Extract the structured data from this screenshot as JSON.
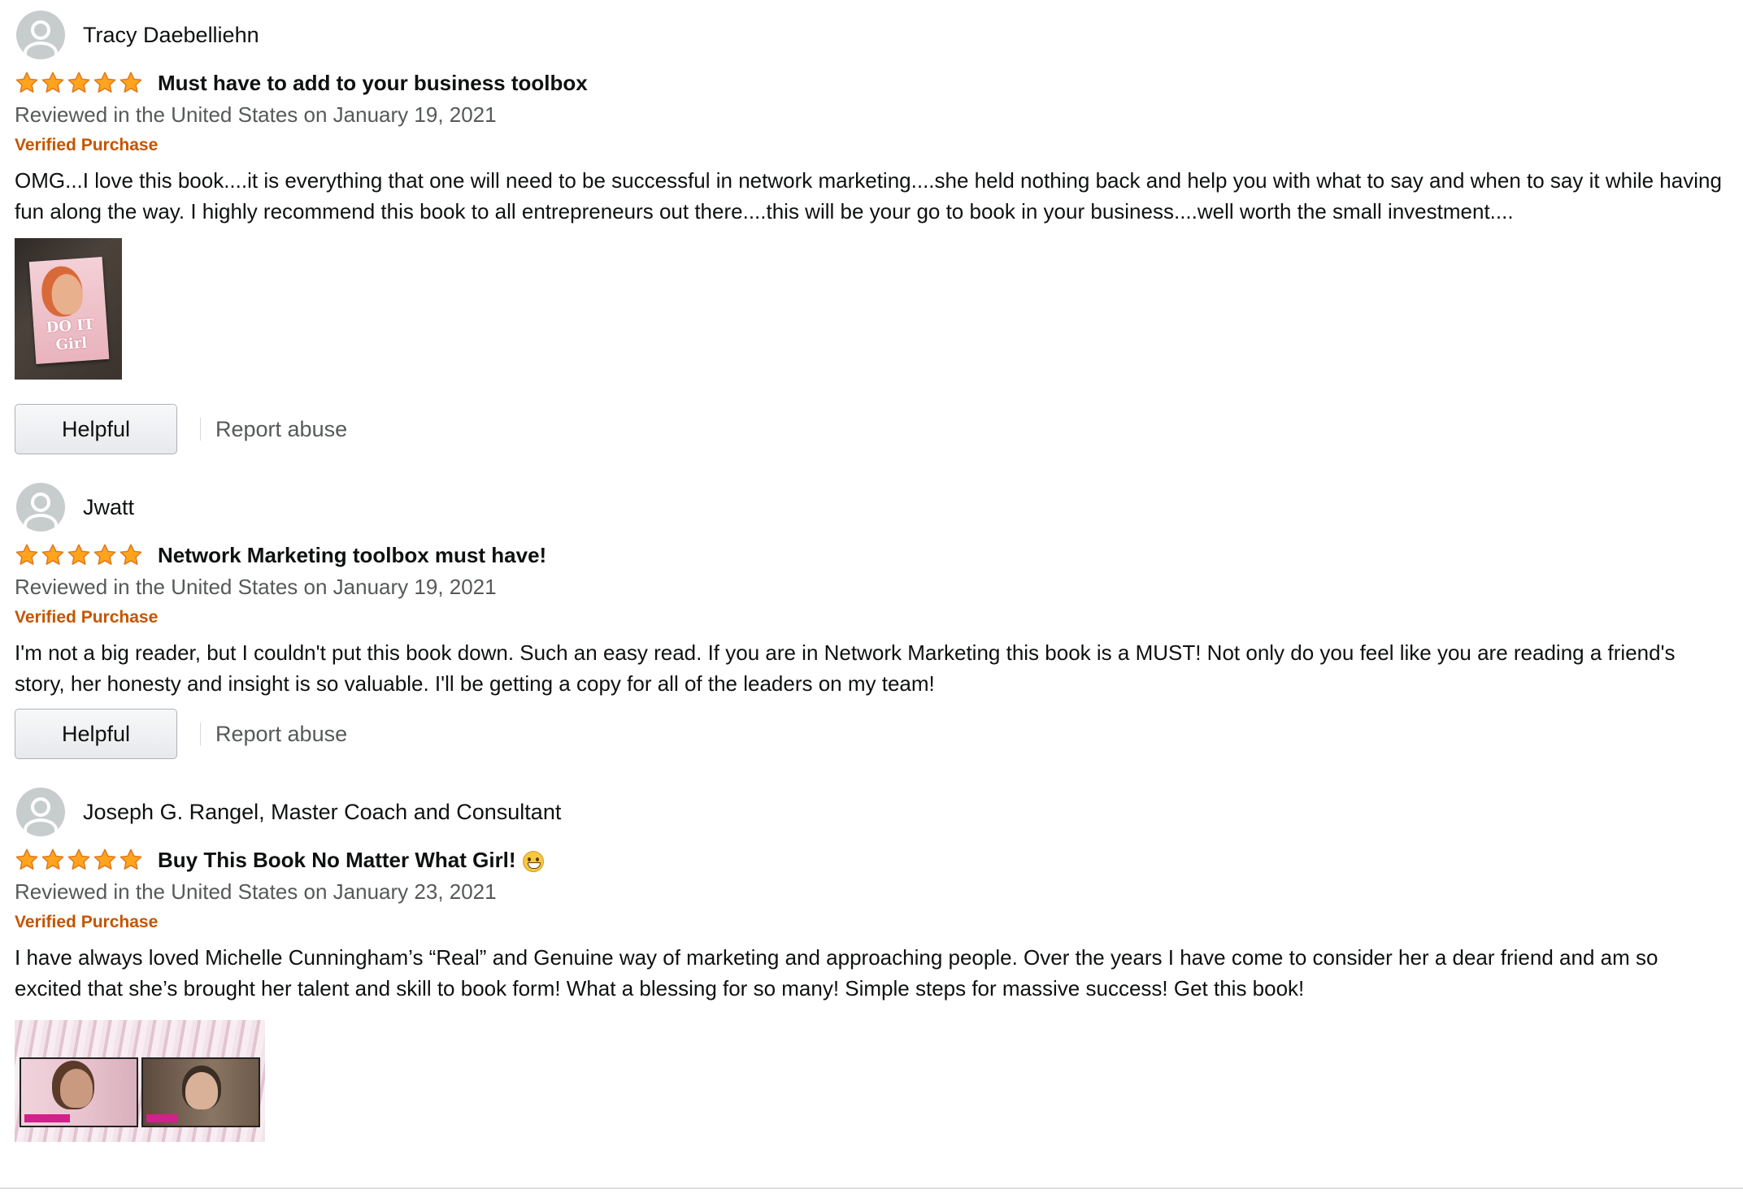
{
  "colors": {
    "verified": "#c45500",
    "meta_text": "#565959",
    "star_fill": "#ffa41c",
    "star_stroke": "#de7921"
  },
  "reviews": [
    {
      "reviewer": "Tracy Daebelliehn",
      "rating": 5,
      "title": "Must have to add to your business toolbox",
      "meta": "Reviewed in the United States on January 19, 2021",
      "verified": "Verified Purchase",
      "body": "OMG...I love this book....it is everything that one will need to be successful in network marketing....she held nothing back and help you with what to say and when to say it while having fun along the way. I highly recommend this book to all entrepreneurs out there....this will be your go to book in your business....well worth the small investment....",
      "image_text": "DO IT Girl",
      "helpful_label": "Helpful",
      "report_label": "Report abuse"
    },
    {
      "reviewer": "Jwatt",
      "rating": 5,
      "title": "Network Marketing toolbox must have!",
      "meta": "Reviewed in the United States on January 19, 2021",
      "verified": "Verified Purchase",
      "body": "I'm not a big reader, but I couldn't put this book down. Such an easy read. If you are in Network Marketing this book is a MUST! Not only do you feel like you are reading a friend's story, her honesty and insight is so valuable. I'll be getting a copy for all of the leaders on my team!",
      "helpful_label": "Helpful",
      "report_label": "Report abuse"
    },
    {
      "reviewer": "Joseph G. Rangel, Master Coach and Consultant",
      "rating": 5,
      "title": "Buy This Book No Matter What Girl!",
      "title_emoji": "grinning-face-emoji",
      "meta": "Reviewed in the United States on January 23, 2021",
      "verified": "Verified Purchase",
      "body": "I have always loved Michelle Cunningham’s “Real” and Genuine way of marketing and approaching people. Over the years I have come to consider her a dear friend and am so excited that she’s brought her talent and skill to book form! What a blessing for so many! Simple steps for massive success! Get this book!"
    }
  ]
}
